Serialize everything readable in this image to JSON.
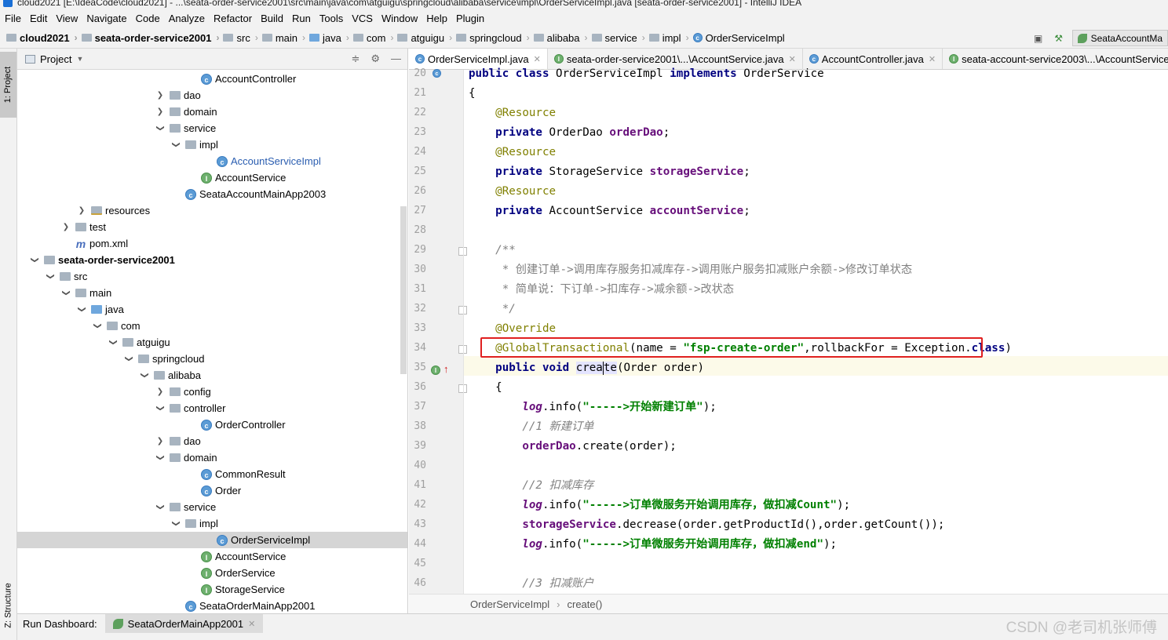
{
  "window": {
    "title": "cloud2021 [E:\\IdeaCode\\cloud2021] - ...\\seata-order-service2001\\src\\main\\java\\com\\atguigu\\springcloud\\alibaba\\service\\impl\\OrderServiceImpl.java [seata-order-service2001] - IntelliJ IDEA"
  },
  "menu": [
    "File",
    "Edit",
    "View",
    "Navigate",
    "Code",
    "Analyze",
    "Refactor",
    "Build",
    "Run",
    "Tools",
    "VCS",
    "Window",
    "Help",
    "Plugin"
  ],
  "breadcrumbs": [
    "cloud2021",
    "seata-order-service2001",
    "src",
    "main",
    "java",
    "com",
    "atguigu",
    "springcloud",
    "alibaba",
    "service",
    "impl",
    "OrderServiceImpl"
  ],
  "run_config": "SeataAccountMa",
  "stripe": {
    "project": "1: Project",
    "structure": "Z: Structure"
  },
  "project_panel": {
    "title": "Project",
    "rows": [
      {
        "label": "AccountController",
        "indent": 11,
        "arrow": "",
        "icon": "cls",
        "style": ""
      },
      {
        "label": "dao",
        "indent": 9,
        "arrow": ">",
        "icon": "fold",
        "style": ""
      },
      {
        "label": "domain",
        "indent": 9,
        "arrow": ">",
        "icon": "fold",
        "style": ""
      },
      {
        "label": "service",
        "indent": 9,
        "arrow": "v",
        "icon": "fold",
        "style": ""
      },
      {
        "label": "impl",
        "indent": 10,
        "arrow": "v",
        "icon": "fold",
        "style": ""
      },
      {
        "label": "AccountServiceImpl",
        "indent": 12,
        "arrow": "",
        "icon": "cls",
        "style": "link"
      },
      {
        "label": "AccountService",
        "indent": 11,
        "arrow": "",
        "icon": "intf",
        "style": ""
      },
      {
        "label": "SeataAccountMainApp2003",
        "indent": 10,
        "arrow": "",
        "icon": "app",
        "style": ""
      },
      {
        "label": "resources",
        "indent": 4,
        "arrow": ">",
        "icon": "res",
        "style": ""
      },
      {
        "label": "test",
        "indent": 3,
        "arrow": ">",
        "icon": "fold",
        "style": ""
      },
      {
        "label": "pom.xml",
        "indent": 3,
        "arrow": "",
        "icon": "mvn",
        "style": ""
      },
      {
        "label": "seata-order-service2001",
        "indent": 1,
        "arrow": "v",
        "icon": "fold",
        "style": "bold"
      },
      {
        "label": "src",
        "indent": 2,
        "arrow": "v",
        "icon": "fold",
        "style": ""
      },
      {
        "label": "main",
        "indent": 3,
        "arrow": "v",
        "icon": "fold",
        "style": ""
      },
      {
        "label": "java",
        "indent": 4,
        "arrow": "v",
        "icon": "foldblue",
        "style": ""
      },
      {
        "label": "com",
        "indent": 5,
        "arrow": "v",
        "icon": "fold",
        "style": ""
      },
      {
        "label": "atguigu",
        "indent": 6,
        "arrow": "v",
        "icon": "fold",
        "style": ""
      },
      {
        "label": "springcloud",
        "indent": 7,
        "arrow": "v",
        "icon": "fold",
        "style": ""
      },
      {
        "label": "alibaba",
        "indent": 8,
        "arrow": "v",
        "icon": "fold",
        "style": ""
      },
      {
        "label": "config",
        "indent": 9,
        "arrow": ">",
        "icon": "fold",
        "style": ""
      },
      {
        "label": "controller",
        "indent": 9,
        "arrow": "v",
        "icon": "fold",
        "style": ""
      },
      {
        "label": "OrderController",
        "indent": 11,
        "arrow": "",
        "icon": "cls",
        "style": ""
      },
      {
        "label": "dao",
        "indent": 9,
        "arrow": ">",
        "icon": "fold",
        "style": ""
      },
      {
        "label": "domain",
        "indent": 9,
        "arrow": "v",
        "icon": "fold",
        "style": ""
      },
      {
        "label": "CommonResult",
        "indent": 11,
        "arrow": "",
        "icon": "cls",
        "style": ""
      },
      {
        "label": "Order",
        "indent": 11,
        "arrow": "",
        "icon": "cls",
        "style": ""
      },
      {
        "label": "service",
        "indent": 9,
        "arrow": "v",
        "icon": "fold",
        "style": ""
      },
      {
        "label": "impl",
        "indent": 10,
        "arrow": "v",
        "icon": "fold",
        "style": ""
      },
      {
        "label": "OrderServiceImpl",
        "indent": 12,
        "arrow": "",
        "icon": "cls",
        "style": "selected"
      },
      {
        "label": "AccountService",
        "indent": 11,
        "arrow": "",
        "icon": "intf",
        "style": ""
      },
      {
        "label": "OrderService",
        "indent": 11,
        "arrow": "",
        "icon": "intf",
        "style": ""
      },
      {
        "label": "StorageService",
        "indent": 11,
        "arrow": "",
        "icon": "intf",
        "style": ""
      },
      {
        "label": "SeataOrderMainApp2001",
        "indent": 10,
        "arrow": "",
        "icon": "app",
        "style": ""
      }
    ]
  },
  "editor_tabs": [
    {
      "label": "OrderServiceImpl.java",
      "icon": "cls",
      "active": true
    },
    {
      "label": "seata-order-service2001\\...\\AccountService.java",
      "icon": "intf",
      "active": false
    },
    {
      "label": "AccountController.java",
      "icon": "cls",
      "active": false
    },
    {
      "label": "seata-account-service2003\\...\\AccountService.",
      "icon": "intf",
      "active": false
    }
  ],
  "code_lines": [
    {
      "n": "20",
      "html": "<span class=\"kw\">public class</span> OrderServiceImpl <span class=\"kw\">implements</span> OrderService"
    },
    {
      "n": "21",
      "html": "{"
    },
    {
      "n": "22",
      "html": "    <span class=\"ann\">@Resource</span>"
    },
    {
      "n": "23",
      "html": "    <span class=\"kw\">private</span> OrderDao <span class=\"fld\">orderDao</span>;"
    },
    {
      "n": "24",
      "html": "    <span class=\"ann\">@Resource</span>"
    },
    {
      "n": "25",
      "html": "    <span class=\"kw\">private</span> StorageService <span class=\"fld\">storageService</span>;"
    },
    {
      "n": "26",
      "html": "    <span class=\"ann\">@Resource</span>"
    },
    {
      "n": "27",
      "html": "    <span class=\"kw\">private</span> AccountService <span class=\"fld\">accountService</span>;"
    },
    {
      "n": "28",
      "html": ""
    },
    {
      "n": "29",
      "html": "    <span class=\"cmt\">/**</span>"
    },
    {
      "n": "30",
      "html": "<span class=\"cmt2\">     * 创建订单-&gt;调用库存服务扣减库存-&gt;调用账户服务扣减账户余额-&gt;修改订单状态</span>"
    },
    {
      "n": "31",
      "html": "<span class=\"cmt2\">     * 简单说：下订单-&gt;扣库存-&gt;减余额-&gt;改状态</span>"
    },
    {
      "n": "32",
      "html": "     <span class=\"cmt\">*/</span>"
    },
    {
      "n": "33",
      "html": "    <span class=\"ann\">@Override</span>"
    },
    {
      "n": "34",
      "html": "    <span class=\"ann\">@GlobalTransactional</span>(name = <span class=\"str\">\"fsp-create-order\"</span>,rollbackFor = Exception.<span class=\"kw\">class</span>)"
    },
    {
      "n": "35",
      "html": "    <span class=\"kw\">public void</span> <span class=\"hl-ident\">crea<span class=\"caret\"></span>te</span>(Order order)"
    },
    {
      "n": "36",
      "html": "    {"
    },
    {
      "n": "37",
      "html": "        <span class=\"logf\">log</span>.info(<span class=\"str\">\"-----&gt;开始新建订单\"</span>);"
    },
    {
      "n": "38",
      "html": "        <span class=\"cmt\">//1 新建订单</span>"
    },
    {
      "n": "39",
      "html": "        <span class=\"fld\">orderDao</span>.create(order);"
    },
    {
      "n": "40",
      "html": ""
    },
    {
      "n": "41",
      "html": "        <span class=\"cmt\">//2 扣减库存</span>"
    },
    {
      "n": "42",
      "html": "        <span class=\"logf\">log</span>.info(<span class=\"str\">\"-----&gt;订单微服务开始调用库存，做扣减Count\"</span>);"
    },
    {
      "n": "43",
      "html": "        <span class=\"fld\">storageService</span>.decrease(order.getProductId(),order.getCount());"
    },
    {
      "n": "44",
      "html": "        <span class=\"logf\">log</span>.info(<span class=\"str\">\"-----&gt;订单微服务开始调用库存，做扣减end\"</span>);"
    },
    {
      "n": "45",
      "html": ""
    },
    {
      "n": "46",
      "html": "        <span class=\"cmt\">//3 扣减账户</span>"
    }
  ],
  "editor_breadcrumb": [
    "OrderServiceImpl",
    "create()"
  ],
  "run_dashboard": {
    "label": "Run Dashboard:",
    "tab": "SeataOrderMainApp2001"
  },
  "watermark": "CSDN @老司机张师傅"
}
